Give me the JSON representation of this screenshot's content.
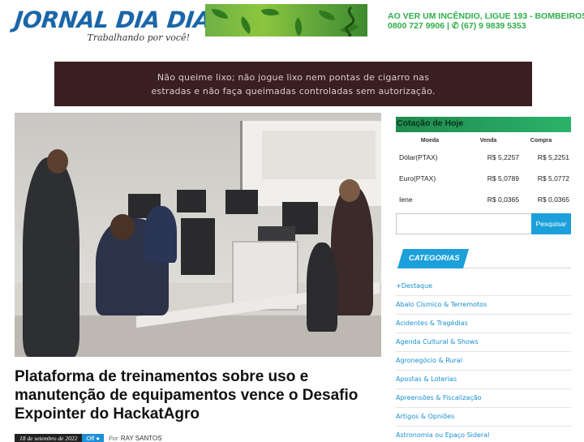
{
  "header": {
    "logo_main": "JORNAL DIA DIA",
    "logo_tagline": "Trabalhando por você!",
    "alert_line1": "AO VER UM INCÊNDIO, LIGUE 193 - BOMBEIROS",
    "alert_line2": "0800 727 9906 | ✆ (67) 9 9839 5353"
  },
  "notice": {
    "line1": "Não queime lixo; não jogue lixo nem pontas de cigarro nas",
    "line2": "estradas e não faça queimadas controladas sem autorização."
  },
  "article": {
    "headline": "Plataforma de treinamentos sobre uso e manutenção de equipamentos vence o Desafio Expointer do HackatAgro",
    "date": "18 de setembro de 2022",
    "comments": "Off",
    "author_prefix": "Por",
    "author": "RAY SANTOS"
  },
  "quotes": {
    "title": "Cotação de Hoje",
    "col_moeda": "Moeda",
    "col_venda": "Venda",
    "col_compra": "Compra",
    "rows": [
      {
        "moeda": "Dólar(PTAX)",
        "venda": "R$ 5,2257",
        "compra": "R$ 5,2251"
      },
      {
        "moeda": "Euro(PTAX)",
        "venda": "R$ 5,0789",
        "compra": "R$ 5,0772"
      },
      {
        "moeda": "Iene",
        "venda": "R$ 0,0365",
        "compra": "R$ 0,0365"
      }
    ]
  },
  "search": {
    "placeholder": "",
    "button": "Pesquisar"
  },
  "categories": {
    "title": "CATEGORIAS",
    "items": [
      "+Destaque",
      "Abalo Císmico & Terremotos",
      "Acidentes & Tragédias",
      "Agenda Cultural & Shows",
      "Agronegócio & Rural",
      "Apostas & Loterias",
      "Apreensões & Fiscalização",
      "Artigos & Opniões",
      "Astronomia ou Epaço Sideral"
    ]
  },
  "colors": {
    "logo_blue": "#1a66a8",
    "alert_green": "#2fae4a",
    "notice_bg": "#3a1e22",
    "accent_blue": "#1ba0db",
    "quotes_green": "#2bb36a"
  }
}
